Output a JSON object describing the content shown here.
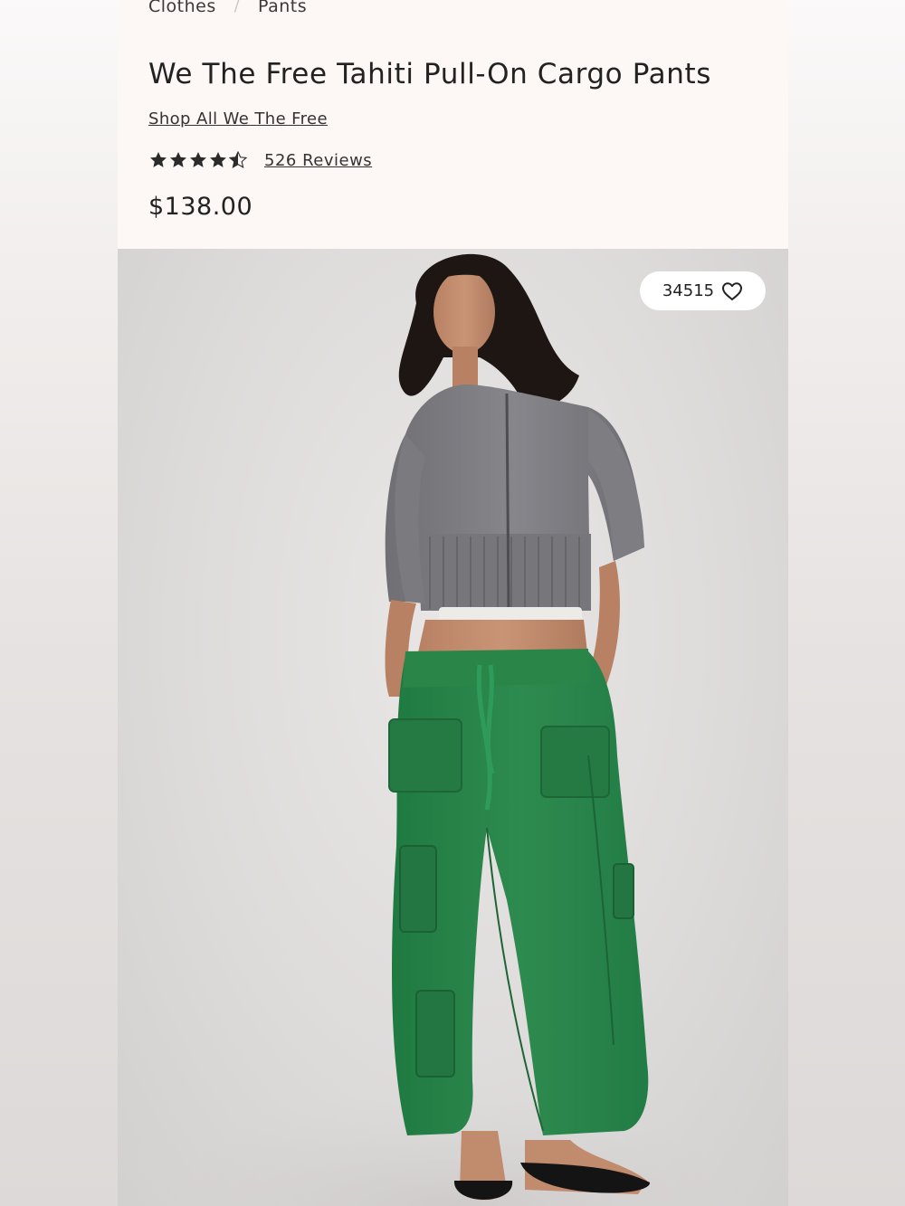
{
  "breadcrumb": {
    "items": [
      "Clothes",
      "Pants"
    ],
    "separator": "/"
  },
  "product": {
    "title": "We The Free Tahiti Pull-On Cargo Pants",
    "brand_link": "Shop All We The Free",
    "rating": 4.5,
    "reviews": "526 Reviews",
    "price": "$138.00"
  },
  "image": {
    "favorite_count": "34515",
    "favorite_icon": "heart-outline-icon"
  },
  "colors": {
    "pants_green": "#2e8b4f",
    "sweater_gray": "#7f7f84",
    "page_background": "#fdf7f6"
  }
}
